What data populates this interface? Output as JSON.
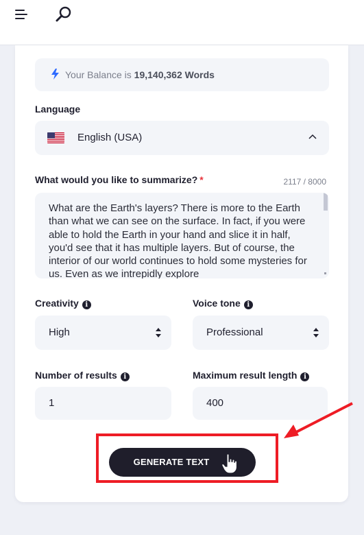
{
  "header": {
    "menu_icon": "hamburger-menu-icon",
    "search_icon": "search-icon"
  },
  "balance": {
    "prefix": "Your Balance is ",
    "amount": "19,140,362 Words",
    "icon": "lightning-bolt-icon"
  },
  "language": {
    "label": "Language",
    "selected": "English (USA)",
    "flag_icon": "us-flag-icon",
    "chevron_icon": "chevron-up-icon"
  },
  "summarize": {
    "label": "What would you like to summarize?",
    "required_mark": "*",
    "counter": "2117 / 8000",
    "text": "What are the Earth's layers?   There is more to the Earth than what we can see on the surface. In fact, if you were able to hold the Earth in your hand and slice it in half, you'd see that it has multiple layers. But of course, the interior of our world continues to hold some mysteries for us. Even as we intrepidly explore"
  },
  "creativity": {
    "label": "Creativity",
    "value": "High"
  },
  "voice_tone": {
    "label": "Voice tone",
    "value": "Professional"
  },
  "num_results": {
    "label": "Number of results",
    "value": "1"
  },
  "max_length": {
    "label": "Maximum result length",
    "value": "400"
  },
  "generate": {
    "label": "GENERATE TEXT"
  },
  "colors": {
    "accent_dark": "#1f1e2b",
    "highlight_red": "#ee1c25",
    "bolt_blue": "#2f6bff"
  }
}
